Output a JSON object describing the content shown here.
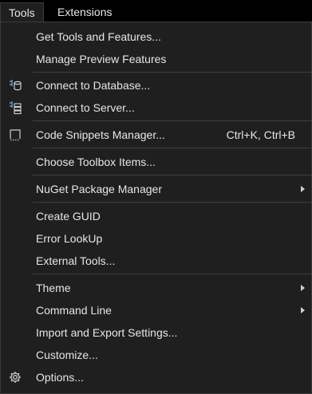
{
  "menubar": {
    "tools_label": "Tools",
    "extensions_label": "Extensions"
  },
  "menu": {
    "items": [
      {
        "label": "Get Tools and Features..."
      },
      {
        "label": "Manage Preview Features"
      },
      {
        "label": "Connect to Database...",
        "icon": "database-connect-icon"
      },
      {
        "label": "Connect to Server...",
        "icon": "server-connect-icon"
      },
      {
        "label": "Code Snippets Manager...",
        "icon": "snippet-icon",
        "shortcut": "Ctrl+K, Ctrl+B"
      },
      {
        "label": "Choose Toolbox Items..."
      },
      {
        "label": "NuGet Package Manager",
        "submenu": true
      },
      {
        "label": "Create GUID"
      },
      {
        "label": "Error LookUp"
      },
      {
        "label": "External Tools..."
      },
      {
        "label": "Theme",
        "submenu": true
      },
      {
        "label": "Command Line",
        "submenu": true
      },
      {
        "label": "Import and Export Settings..."
      },
      {
        "label": "Customize..."
      },
      {
        "label": "Options...",
        "icon": "gear-icon"
      }
    ]
  },
  "colors": {
    "background": "#1f1f1f",
    "text": "#e6e6e6",
    "separator": "#3f3f46",
    "icon_blue": "#4fa3e0"
  }
}
